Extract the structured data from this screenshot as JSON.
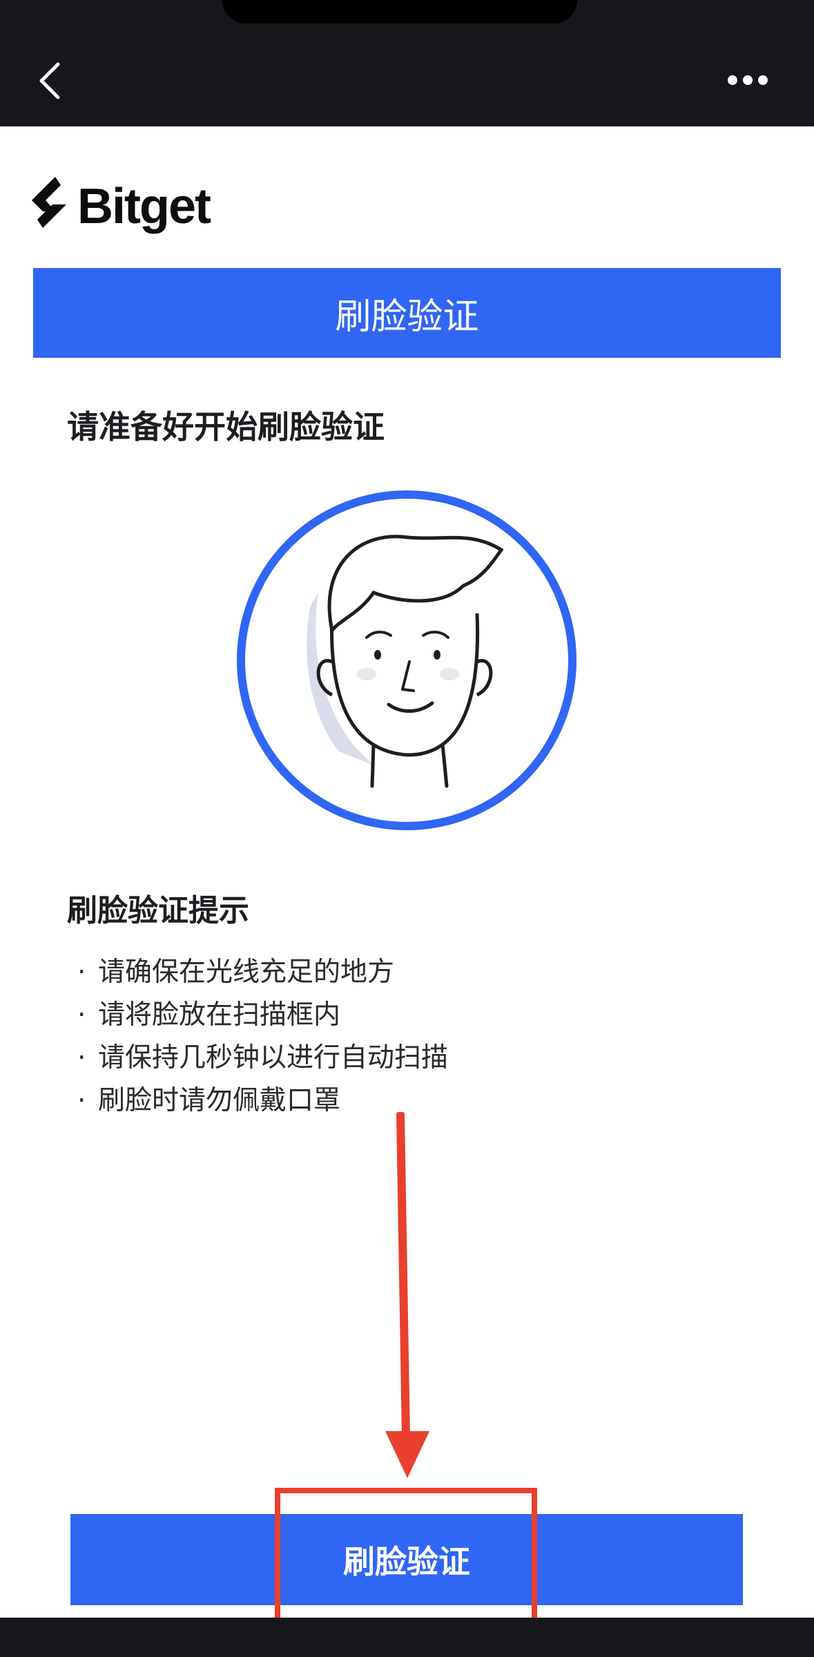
{
  "nav": {
    "back_icon": "chevron-left-icon",
    "more_icon": "more-horizontal-icon"
  },
  "brand": {
    "logo_text": "Bitget",
    "logo_icon": "bitget-logo-icon"
  },
  "banner": {
    "title": "刷脸验证"
  },
  "prepare": {
    "title": "请准备好开始刷脸验证",
    "illustration_icon": "face-illustration-icon"
  },
  "tips": {
    "title": "刷脸验证提示",
    "items": [
      "请确保在光线充足的地方",
      "请将脸放在扫描框内",
      "请保持几秒钟以进行自动扫描",
      "刷脸时请勿佩戴口罩"
    ],
    "bullet": "·"
  },
  "action": {
    "verify_label": "刷脸验证"
  },
  "colors": {
    "primary": "#2f66f4",
    "annotation": "#e8402d",
    "topbar": "#16161b"
  }
}
